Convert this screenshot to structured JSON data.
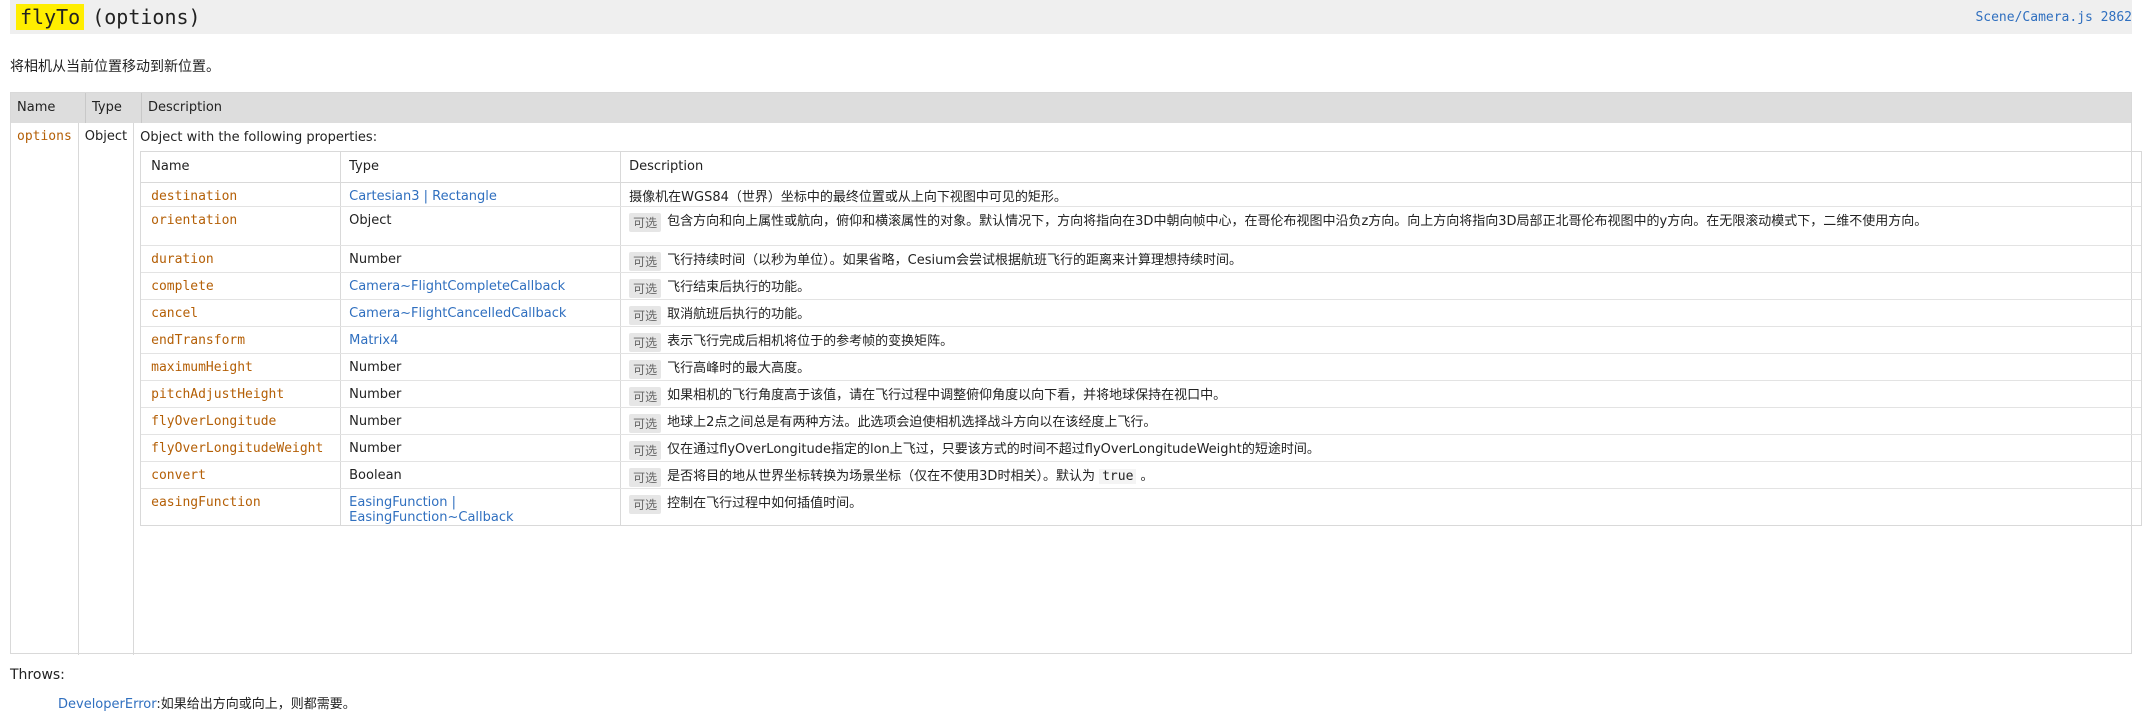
{
  "method": {
    "name": "flyTo",
    "params_sig": "(options)",
    "source": "Scene/Camera.js 2862",
    "summary": "将相机从当前位置移动到新位置。"
  },
  "params_table": {
    "headers": [
      "Name",
      "Type",
      "Description"
    ],
    "options": {
      "name": "options",
      "type": "Object",
      "intro": "Object with the following properties:"
    },
    "inner_headers": [
      "Name",
      "Type",
      "Description"
    ],
    "rows": [
      {
        "name": "destination",
        "type": "Cartesian3 | Rectangle",
        "optional": "",
        "desc": "摄像机在WGS84（世界）坐标中的最终位置或从上向下视图中可见的矩形。"
      },
      {
        "name": "orientation",
        "type": "Object",
        "optional": "可选",
        "desc": "包含方向和向上属性或航向，俯仰和横滚属性的对象。默认情况下，方向将指向在3D中朝向帧中心，在哥伦布视图中沿负z方向。向上方向将指向3D局部正北哥伦布视图中的y方向。在无限滚动模式下，二维不使用方向。"
      },
      {
        "name": "duration",
        "type": "Number",
        "optional": "可选",
        "desc": "飞行持续时间（以秒为单位）。如果省略，Cesium会尝试根据航班飞行的距离来计算理想持续时间。"
      },
      {
        "name": "complete",
        "type": "Camera~FlightCompleteCallback",
        "optional": "可选",
        "desc": "飞行结束后执行的功能。"
      },
      {
        "name": "cancel",
        "type": "Camera~FlightCancelledCallback",
        "optional": "可选",
        "desc": "取消航班后执行的功能。"
      },
      {
        "name": "endTransform",
        "type": "Matrix4",
        "optional": "可选",
        "desc": "表示飞行完成后相机将位于的参考帧的变换矩阵。"
      },
      {
        "name": "maximumHeight",
        "type": "Number",
        "optional": "可选",
        "desc": "飞行高峰时的最大高度。"
      },
      {
        "name": "pitchAdjustHeight",
        "type": "Number",
        "optional": "可选",
        "desc": "如果相机的飞行角度高于该值，请在飞行过程中调整俯仰角度以向下看，并将地球保持在视口中。"
      },
      {
        "name": "flyOverLongitude",
        "type": "Number",
        "optional": "可选",
        "desc": "地球上2点之间总是有两种方法。此选项会迫使相机选择战斗方向以在该经度上飞行。"
      },
      {
        "name": "flyOverLongitudeWeight",
        "type": "Number",
        "optional": "可选",
        "desc": "仅在通过flyOverLongitude指定的lon上飞过，只要该方式的时间不超过flyOverLongitudeWeight的短途时间。"
      },
      {
        "name": "convert",
        "type": "Boolean",
        "optional": "可选",
        "desc_pre": "是否将目的地从世界坐标转换为场景坐标（仅在不使用3D时相关）。默认为",
        "desc_code": "true",
        "desc_post": "。"
      },
      {
        "name": "easingFunction",
        "type_line1": "EasingFunction |",
        "type_line2": "EasingFunction~Callback",
        "optional": "可选",
        "desc": "控制在飞行过程中如何插值时间。"
      }
    ]
  },
  "throws": {
    "title": "Throws:",
    "error_type": "DeveloperError",
    "error_desc": ":如果给出方向或向上，则都需要。"
  },
  "colors": {
    "highlight": "#ffee00",
    "link": "#2f6fbf",
    "param_name": "#b45f06",
    "header_bg": "#efefef",
    "table_head_bg": "#dddddd"
  }
}
